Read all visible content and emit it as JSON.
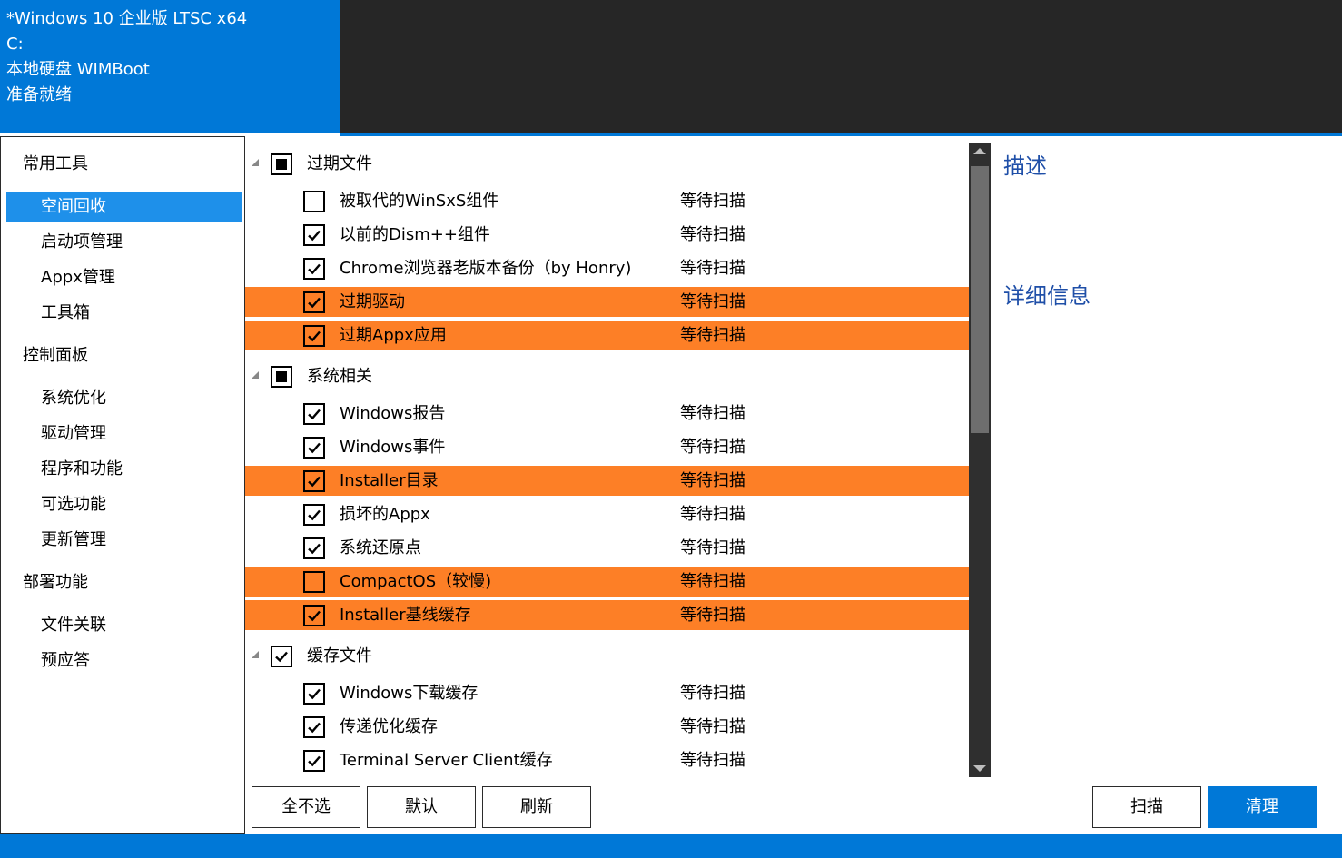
{
  "colors": {
    "accent": "#0078d7",
    "highlight": "#fd7f26",
    "dark": "#262626",
    "heading": "#1f4fa8"
  },
  "header": {
    "lines": [
      "*Windows 10 企业版 LTSC x64",
      "C:",
      "本地硬盘 WIMBoot",
      "准备就绪"
    ]
  },
  "sidebar": {
    "groups": [
      {
        "title": "常用工具",
        "items": [
          "空间回收",
          "启动项管理",
          "Appx管理",
          "工具箱"
        ]
      },
      {
        "title": "控制面板",
        "items": [
          "系统优化",
          "驱动管理",
          "程序和功能",
          "可选功能",
          "更新管理"
        ]
      },
      {
        "title": "部署功能",
        "items": [
          "文件关联",
          "预应答"
        ]
      }
    ],
    "selected": "空间回收"
  },
  "list": {
    "categories": [
      {
        "label": "过期文件",
        "state": "partial",
        "items": [
          {
            "label": "被取代的WinSxS组件",
            "status": "等待扫描",
            "checked": false,
            "highlight": false
          },
          {
            "label": "以前的Dism++组件",
            "status": "等待扫描",
            "checked": true,
            "highlight": false
          },
          {
            "label": "Chrome浏览器老版本备份（by Honry)",
            "status": "等待扫描",
            "checked": true,
            "highlight": false
          },
          {
            "label": "过期驱动",
            "status": "等待扫描",
            "checked": true,
            "highlight": true
          },
          {
            "label": "过期Appx应用",
            "status": "等待扫描",
            "checked": true,
            "highlight": true
          }
        ]
      },
      {
        "label": "系统相关",
        "state": "partial",
        "items": [
          {
            "label": "Windows报告",
            "status": "等待扫描",
            "checked": true,
            "highlight": false
          },
          {
            "label": "Windows事件",
            "status": "等待扫描",
            "checked": true,
            "highlight": false
          },
          {
            "label": "Installer目录",
            "status": "等待扫描",
            "checked": true,
            "highlight": true
          },
          {
            "label": "损坏的Appx",
            "status": "等待扫描",
            "checked": true,
            "highlight": false
          },
          {
            "label": "系统还原点",
            "status": "等待扫描",
            "checked": true,
            "highlight": false
          },
          {
            "label": "CompactOS（较慢)",
            "status": "等待扫描",
            "checked": false,
            "highlight": true
          },
          {
            "label": "Installer基线缓存",
            "status": "等待扫描",
            "checked": true,
            "highlight": true
          }
        ]
      },
      {
        "label": "缓存文件",
        "state": "checked",
        "items": [
          {
            "label": "Windows下载缓存",
            "status": "等待扫描",
            "checked": true,
            "highlight": false
          },
          {
            "label": "传递优化缓存",
            "status": "等待扫描",
            "checked": true,
            "highlight": false
          },
          {
            "label": "Terminal Server Client缓存",
            "status": "等待扫描",
            "checked": true,
            "highlight": false
          }
        ]
      }
    ]
  },
  "description": {
    "title": "描述",
    "details_title": "详细信息"
  },
  "buttons": {
    "deselect_all": "全不选",
    "default": "默认",
    "refresh": "刷新",
    "scan": "扫描",
    "clean": "清理"
  }
}
